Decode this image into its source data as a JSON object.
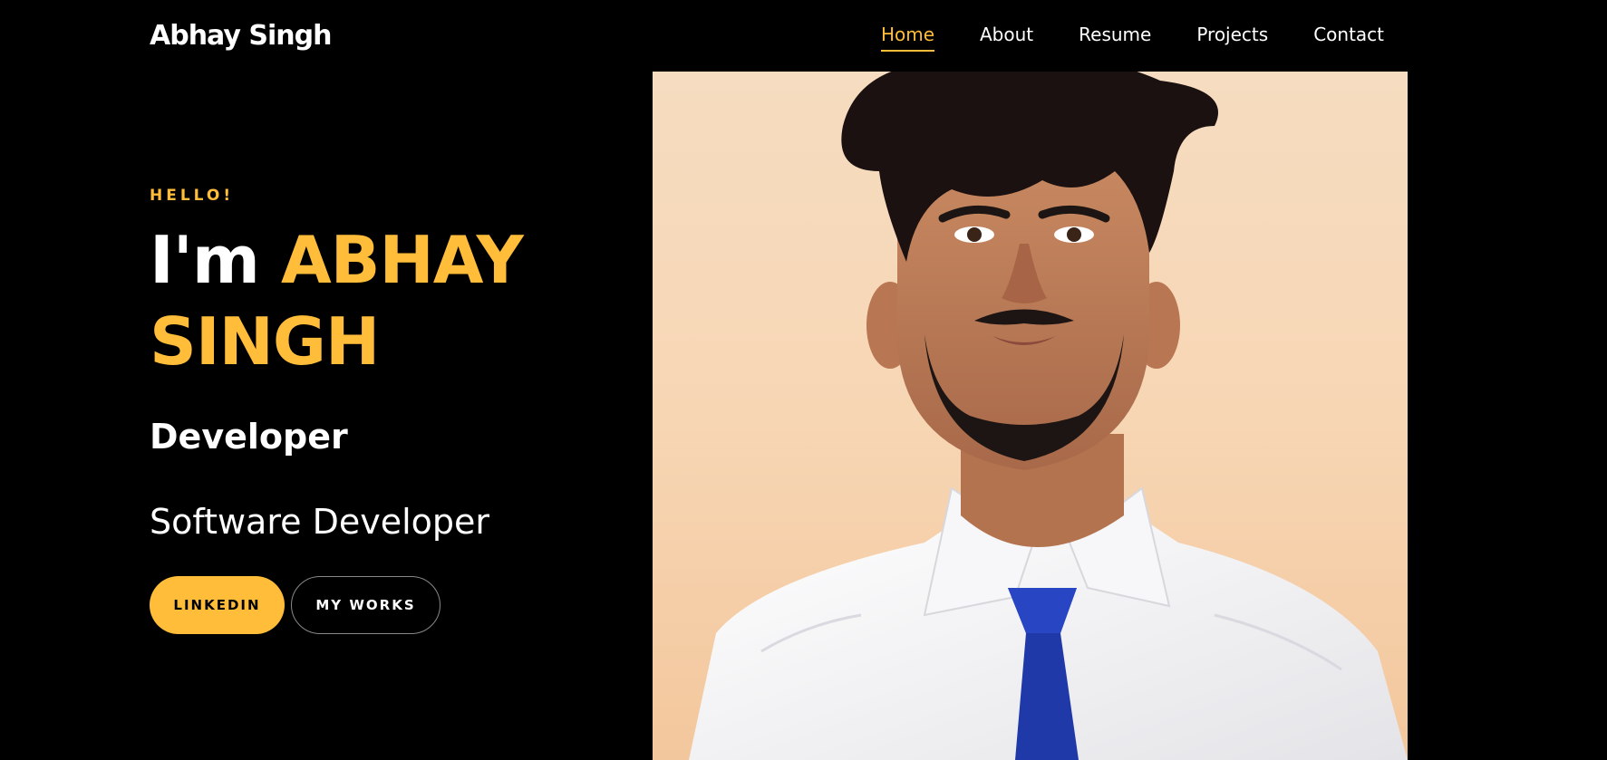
{
  "header": {
    "brand": "Abhay Singh",
    "nav": [
      "Home",
      "About",
      "Resume",
      "Projects",
      "Contact"
    ],
    "active_nav": "Home"
  },
  "hero": {
    "greeting": "HELLO!",
    "intro": "I'm",
    "name_first": "ABHAY",
    "name_last": "SINGH",
    "role": "Developer",
    "subrole": "Software Developer",
    "buttons": {
      "primary": "LINKEDIN",
      "secondary": "MY WORKS"
    }
  },
  "colors": {
    "accent": "#ffbd39",
    "background": "#000000",
    "text": "#ffffff"
  },
  "portrait": {
    "subject": "portrait photo"
  }
}
